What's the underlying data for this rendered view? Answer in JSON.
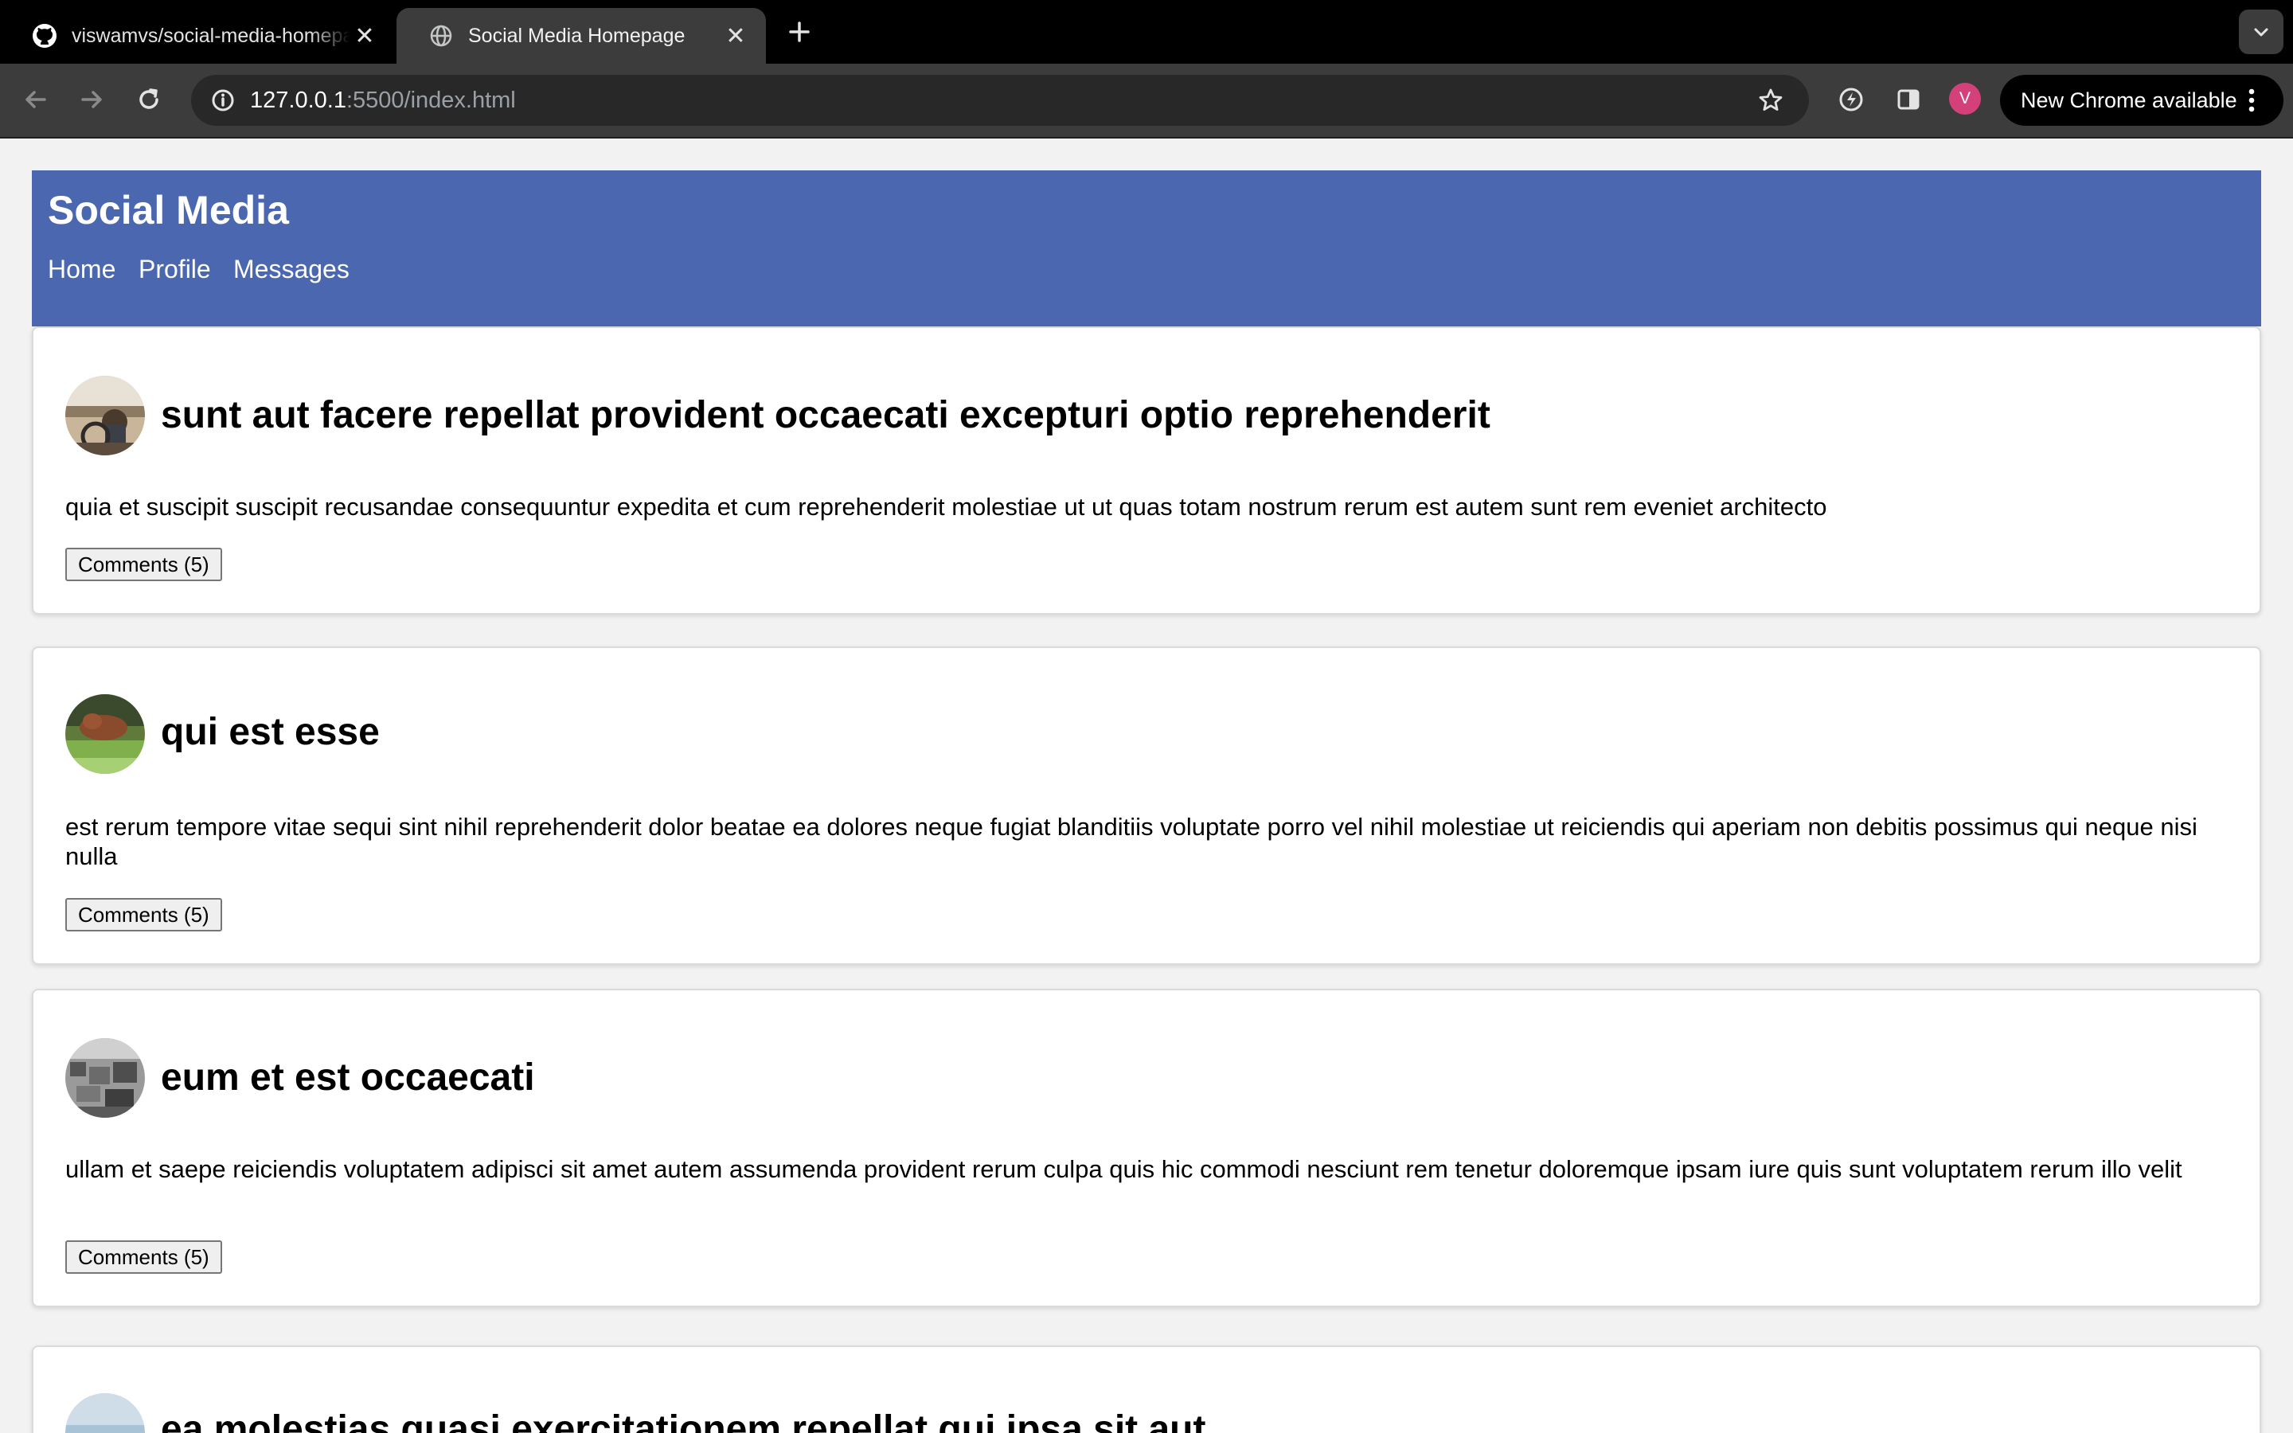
{
  "browser": {
    "tabs": [
      {
        "title": "viswamvs/social-media-homepage",
        "icon": "github-icon",
        "active": false
      },
      {
        "title": "Social Media Homepage",
        "icon": "globe-icon",
        "active": true
      }
    ],
    "url_host": "127.0.0.1",
    "url_rest": ":5500/index.html",
    "profile_initial": "V",
    "update_label": "New Chrome available"
  },
  "site": {
    "title": "Social Media",
    "nav": [
      "Home",
      "Profile",
      "Messages"
    ],
    "header_color": "#4a67b0"
  },
  "posts": [
    {
      "title": "sunt aut facere repellat provident occaecati excepturi optio reprehenderit",
      "body": "quia et suscipit suscipit recusandae consequuntur expedita et cum reprehenderit molestiae ut ut quas totam nostrum rerum est autem sunt rem eveniet architecto",
      "comments_label": "Comments (5)"
    },
    {
      "title": "qui est esse",
      "body": "est rerum tempore vitae sequi sint nihil reprehenderit dolor beatae ea dolores neque fugiat blanditiis voluptate porro vel nihil molestiae ut reiciendis qui aperiam non debitis possimus qui neque nisi nulla",
      "comments_label": "Comments (5)"
    },
    {
      "title": "eum et est occaecati",
      "body": "ullam et saepe reiciendis voluptatem adipisci sit amet autem assumenda provident rerum culpa quis hic commodi nesciunt rem tenetur doloremque ipsam iure quis sunt voluptatem rerum illo velit",
      "comments_label": "Comments (5)"
    },
    {
      "title": "ea molestias quasi exercitationem repellat qui ipsa sit aut"
    }
  ]
}
